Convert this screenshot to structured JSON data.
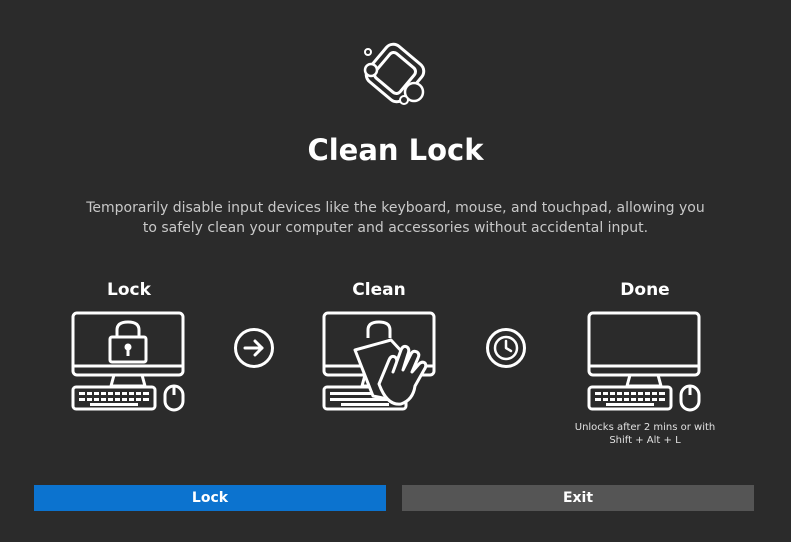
{
  "app": {
    "title": "Clean Lock",
    "description": "Temporarily disable input devices like the keyboard, mouse, and touchpad, allowing you to safely clean your computer and accessories without accidental input."
  },
  "steps": [
    {
      "label": "Lock",
      "icon": "monitor-lock-icon"
    },
    {
      "label": "Clean",
      "icon": "monitor-wipe-icon"
    },
    {
      "label": "Done",
      "icon": "monitor-icon",
      "note_line1": "Unlocks after 2 mins or with",
      "note_line2": "Shift + Alt + L"
    }
  ],
  "connectors": [
    "arrow-right-icon",
    "clock-icon"
  ],
  "buttons": {
    "lock_label": "Lock",
    "exit_label": "Exit"
  },
  "colors": {
    "background": "#2b2b2b",
    "primary_button": "#0c73cf",
    "secondary_button": "#555555"
  }
}
